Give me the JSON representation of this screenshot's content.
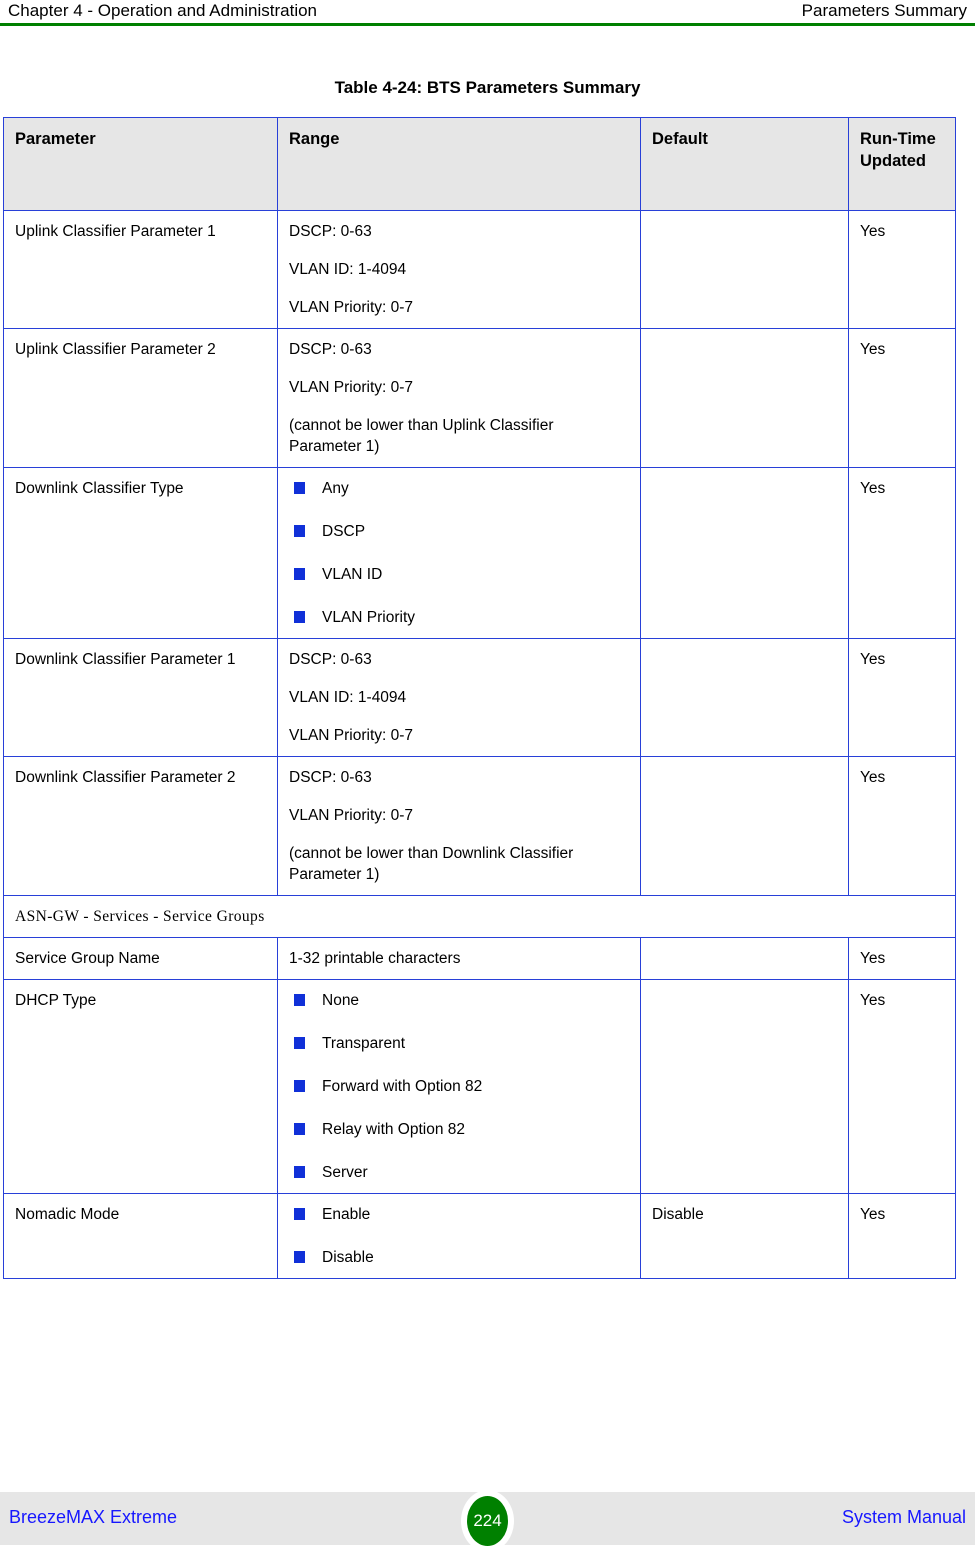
{
  "header": {
    "left": "Chapter 4 - Operation and Administration",
    "right": "Parameters Summary",
    "rule_color": "#008000"
  },
  "table_title": "Table 4-24: BTS Parameters Summary",
  "table": {
    "columns": [
      "Parameter",
      "Range",
      "Default",
      "Run-Time Updated"
    ],
    "column_headers": {
      "parameter": "Parameter",
      "range": "Range",
      "default": "Default",
      "run_time_updated_line1": "Run-Time",
      "run_time_updated_line2": "Updated"
    },
    "border_color": "#2840d8",
    "header_bg": "#e6e6e6",
    "bullet_color": "#1030d8",
    "rows": [
      {
        "type": "data",
        "parameter": "Uplink Classifier Parameter 1",
        "range_lines": [
          "DSCP: 0-63",
          "VLAN ID: 1-4094",
          "VLAN Priority: 0-7"
        ],
        "default": "",
        "run_time_updated": "Yes"
      },
      {
        "type": "data",
        "parameter": "Uplink Classifier Parameter 2",
        "range_lines": [
          "DSCP: 0-63",
          "VLAN Priority: 0-7",
          "(cannot be lower than Uplink Classifier Parameter 1)"
        ],
        "default": "",
        "run_time_updated": "Yes"
      },
      {
        "type": "bullets",
        "parameter": "Downlink Classifier Type",
        "range_bullets": [
          "Any",
          "DSCP",
          "VLAN ID",
          "VLAN Priority"
        ],
        "default": "",
        "run_time_updated": "Yes"
      },
      {
        "type": "data",
        "parameter": "Downlink Classifier Parameter 1",
        "range_lines": [
          "DSCP: 0-63",
          "VLAN ID: 1-4094",
          "VLAN Priority: 0-7"
        ],
        "default": "",
        "run_time_updated": "Yes"
      },
      {
        "type": "data",
        "parameter": "Downlink Classifier Parameter 2",
        "range_lines": [
          "DSCP: 0-63",
          "VLAN Priority: 0-7",
          "(cannot be lower than Downlink Classifier Parameter 1)"
        ],
        "default": "",
        "run_time_updated": "Yes"
      },
      {
        "type": "section",
        "section_title": "ASN-GW - Services - Service Groups"
      },
      {
        "type": "data",
        "parameter": "Service Group Name",
        "range_lines": [
          "1-32 printable characters"
        ],
        "default": "",
        "run_time_updated": "Yes"
      },
      {
        "type": "bullets",
        "parameter": "DHCP Type",
        "range_bullets": [
          "None",
          "Transparent",
          "Forward with Option 82",
          "Relay with Option 82",
          "Server"
        ],
        "default": "",
        "run_time_updated": "Yes"
      },
      {
        "type": "bullets",
        "parameter": "Nomadic Mode",
        "range_bullets": [
          "Enable",
          "Disable"
        ],
        "default": "Disable",
        "run_time_updated": "Yes"
      }
    ]
  },
  "footer": {
    "left": "BreezeMAX Extreme",
    "page_number": "224",
    "right": "System Manual",
    "band_color": "#e6e6e6",
    "text_color": "#1717ff",
    "badge_color": "#008000"
  }
}
